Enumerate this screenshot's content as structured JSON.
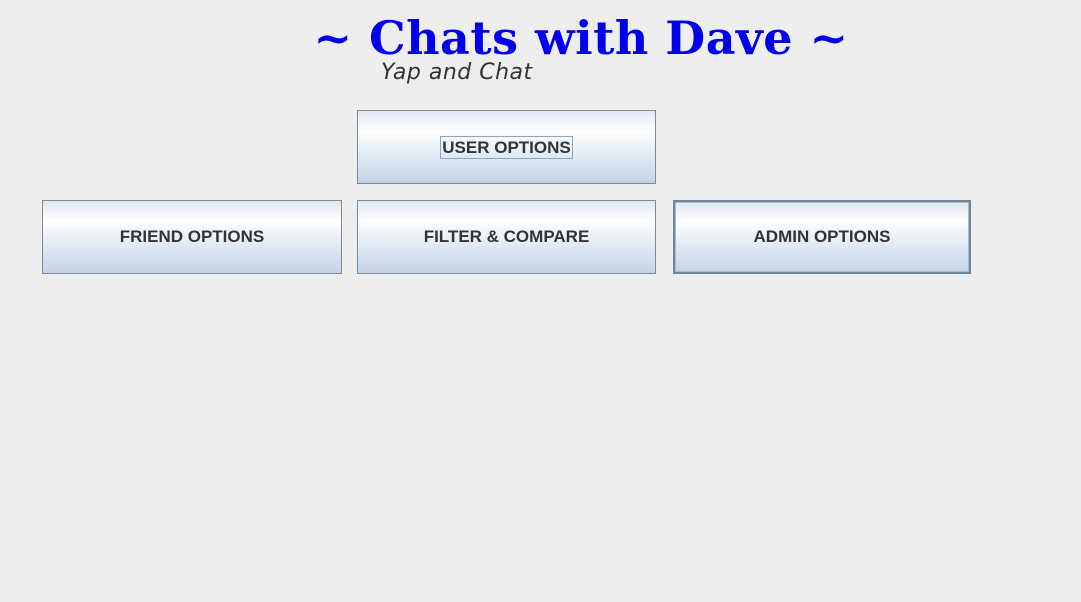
{
  "header": {
    "title": "~ Chats with Dave ~",
    "subtitle": "Yap and Chat"
  },
  "buttons": {
    "user_options": "USER OPTIONS",
    "friend_options": "FRIEND OPTIONS",
    "filter_compare": "FILTER & COMPARE",
    "admin_options": "ADMIN OPTIONS"
  },
  "colors": {
    "title": "#0000ee",
    "background": "#eeeeee",
    "button_text": "#333333"
  }
}
